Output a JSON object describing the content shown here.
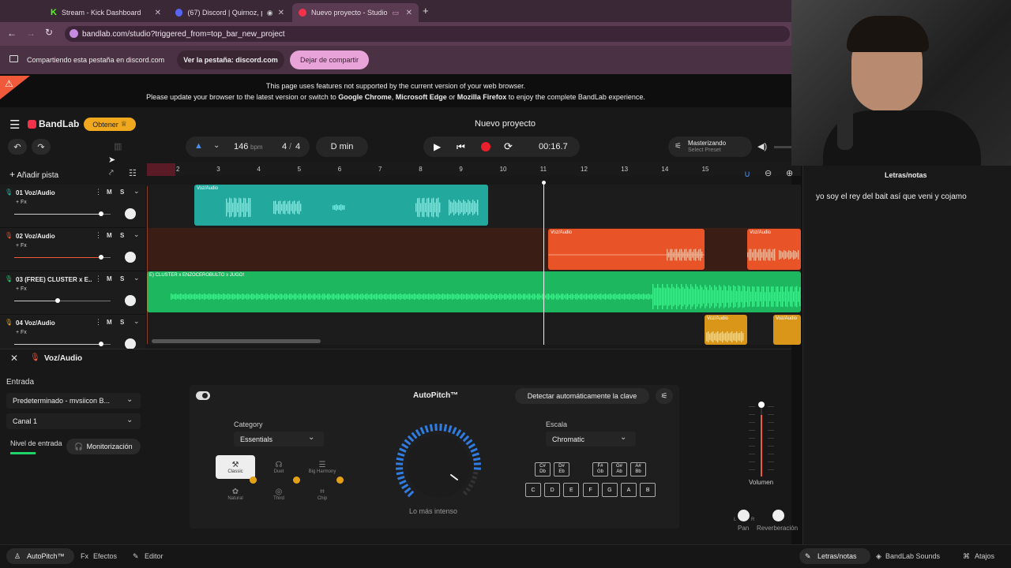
{
  "tabs": [
    {
      "label": "Stream - Kick Dashboard",
      "icon": "kick-icon",
      "color": "#53fc18"
    },
    {
      "label": "(67) Discord | Quirnoz, pe",
      "icon": "discord-icon",
      "color": "#5865f2"
    },
    {
      "label": "Nuevo proyecto - Studio",
      "icon": "bandlab-icon",
      "color": "#f2324a"
    }
  ],
  "address": {
    "url": "bandlab.com/studio?triggered_from=top_bar_new_project"
  },
  "share": {
    "text": "Compartiendo esta pestaña en discord.com",
    "view_label": "Ver la pestaña: discord.com",
    "stop_label": "Dejar de compartir"
  },
  "warning": {
    "line1": "This page uses features not supported by the current version of your web browser.",
    "pre": "Please update your browser to the latest version or switch to ",
    "b1": "Google Chrome",
    "sep1": ", ",
    "b2": "Microsoft Edge",
    "sep2": " or ",
    "b3": "Mozilla Firefox",
    "post": " to enjoy the complete BandLab experience."
  },
  "header": {
    "brand": "BandLab",
    "get_label": "Obtener",
    "project_title": "Nuevo proyecto"
  },
  "transport": {
    "tempo": "146",
    "tempo_unit": "bpm",
    "time_sig_top": "4",
    "time_sig_sep": "/",
    "time_sig_bottom": "4",
    "key": "D min",
    "time": "00:16.7",
    "mastering_title": "Masterizando",
    "mastering_sub": "Select Preset"
  },
  "track_controls": {
    "add_track": "Añadir pista",
    "mute": "M",
    "solo": "S",
    "fx": "+ Fx"
  },
  "ruler": [
    "2",
    "3",
    "4",
    "5",
    "6",
    "7",
    "8",
    "9",
    "10",
    "11",
    "12",
    "13",
    "14",
    "15"
  ],
  "tracks": [
    {
      "name": "01  Voz/Audio",
      "color": "#22b3a8",
      "volume": 0.9
    },
    {
      "name": "02  Voz/Audio",
      "color": "#f0542a",
      "volume": 0.9
    },
    {
      "name": "03  (FREE) CLUSTER x E...",
      "color": "#1fd36b",
      "volume": 0.45
    },
    {
      "name": "04  Voz/Audio",
      "color": "#e3a118",
      "volume": 0.9
    }
  ],
  "clips": {
    "voz": "Voz/Audio",
    "beat": "E) CLUSTER x ENZOCEROBULTO x JUGO!"
  },
  "track_panel": {
    "name": "Voz/Audio",
    "input_label": "Entrada",
    "input_device": "Predeterminado - mvsiicon B...",
    "channel": "Canal 1",
    "level_label": "Nivel de entrada",
    "monitor_label": "Monitorización"
  },
  "autopitch": {
    "title": "AutoPitch™",
    "detect_label": "Detectar automáticamente la clave",
    "category_label": "Category",
    "category_value": "Essentials",
    "scale_label": "Escala",
    "scale_value": "Chromatic",
    "dial_caption": "Lo más intenso",
    "amount": 0.85,
    "modes": [
      {
        "label": "Classic",
        "icon": "wand-icon"
      },
      {
        "label": "Duet",
        "icon": "duet-icon"
      },
      {
        "label": "Big Harmony",
        "icon": "harmony-icon"
      },
      {
        "label": "Natural",
        "icon": "natural-icon"
      },
      {
        "label": "Third",
        "icon": "third-icon"
      },
      {
        "label": "Chip",
        "icon": "chip-icon"
      }
    ],
    "black_keys": [
      {
        "top": "C#",
        "bottom": "Db"
      },
      {
        "top": "D#",
        "bottom": "Eb"
      },
      {
        "top": "F#",
        "bottom": "Gb"
      },
      {
        "top": "G#",
        "bottom": "Ab"
      },
      {
        "top": "A#",
        "bottom": "Bb"
      }
    ],
    "white_keys": [
      "C",
      "D",
      "E",
      "F",
      "G",
      "A",
      "B"
    ]
  },
  "mixer": {
    "volume_label": "Volumen",
    "pan_label": "Pan",
    "reverb_label": "Reverberación",
    "pan_l": "L",
    "pan_r": "R",
    "volume_level": 0.85
  },
  "notes": {
    "title": "Letras/notas",
    "content": "yo soy el rey del bait así que veni y cojamo"
  },
  "bottom_tabs": {
    "autopitch": "AutoPitch™",
    "effects": "Efectos",
    "editor": "Editor",
    "notes": "Letras/notas",
    "sounds": "BandLab Sounds",
    "shortcuts": "Atajos"
  }
}
